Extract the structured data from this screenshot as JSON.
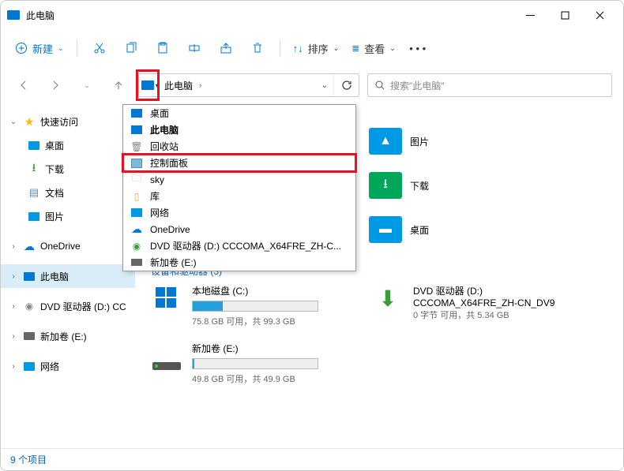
{
  "title": "此电脑",
  "toolbar": {
    "new": "新建",
    "sort": "排序",
    "view": "查看"
  },
  "addr": {
    "crumb": "此电脑",
    "search_placeholder": "搜索\"此电脑\""
  },
  "dropdown": {
    "items": [
      {
        "label": "桌面",
        "icon": "monitor"
      },
      {
        "label": "此电脑",
        "icon": "monitor",
        "bold": true
      },
      {
        "label": "回收站",
        "icon": "bin"
      },
      {
        "label": "控制面板",
        "icon": "cp",
        "highlight": true
      },
      {
        "label": "sky",
        "icon": "folder"
      },
      {
        "label": "库",
        "icon": "lib"
      },
      {
        "label": "网络",
        "icon": "net"
      },
      {
        "label": "OneDrive",
        "icon": "cloud"
      },
      {
        "label": "DVD 驱动器 (D:) CCCOMA_X64FRE_ZH-C...",
        "icon": "dvd"
      },
      {
        "label": "新加卷 (E:)",
        "icon": "disk"
      }
    ]
  },
  "sidebar": {
    "quick": "快速访问",
    "items": [
      "桌面",
      "下载",
      "文档",
      "图片"
    ],
    "onedrive": "OneDrive",
    "thispc": "此电脑",
    "dvd": "DVD 驱动器 (D:) CC",
    "vol": "新加卷 (E:)",
    "net": "网络"
  },
  "folders_right": [
    "图片",
    "下载",
    "桌面"
  ],
  "section_devices": "设备和驱动器 (3)",
  "drives": {
    "c": {
      "name": "本地磁盘 (C:)",
      "free": "75.8 GB 可用，共 99.3 GB",
      "pct": 24
    },
    "e": {
      "name": "新加卷 (E:)",
      "free": "49.8 GB 可用，共 49.9 GB",
      "pct": 1
    },
    "d": {
      "name": "DVD 驱动器 (D:)",
      "label": "CCCOMA_X64FRE_ZH-CN_DV9",
      "free": "0 字节 可用，共 5.34 GB"
    }
  },
  "status": "9 个项目"
}
